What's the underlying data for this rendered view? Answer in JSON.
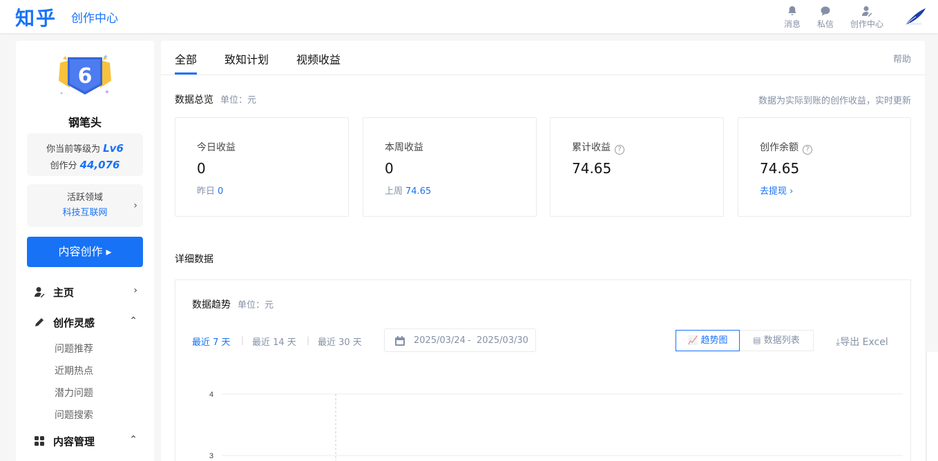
{
  "header": {
    "logo": "知乎",
    "subtitle": "创作中心",
    "items": [
      {
        "label": "消息",
        "icon": "bell-icon"
      },
      {
        "label": "私信",
        "icon": "chat-icon"
      },
      {
        "label": "创作中心",
        "icon": "creator-icon"
      }
    ],
    "avatar_icon": "feather-logo-icon"
  },
  "sidebar": {
    "badge_number": "6",
    "level_name": "钢笔头",
    "level_text": "你当前等级为",
    "level_value": "Lv6",
    "score_text": "创作分",
    "score_value": "44,076",
    "domain_label": "活跃领域",
    "domain_value": "科技互联网",
    "create_button": "内容创作 ▸",
    "nav": [
      {
        "label": "主页",
        "icon": "user-icon",
        "chevron": "›"
      },
      {
        "label": "创作灵感",
        "icon": "pen-icon",
        "chevron": "⌃",
        "children": [
          "问题推荐",
          "近期热点",
          "潜力问题",
          "问题搜索"
        ]
      },
      {
        "label": "内容管理",
        "icon": "grid-icon",
        "chevron": "⌃"
      }
    ]
  },
  "main": {
    "tabs": [
      "全部",
      "致知计划",
      "视频收益"
    ],
    "help": "帮助",
    "overview_title": "数据总览",
    "overview_unit": "单位：元",
    "overview_note": "数据为实际到账的创作收益，实时更新",
    "cards": [
      {
        "title": "今日收益",
        "value": "0",
        "sub_label": "昨日",
        "sub_value": "0"
      },
      {
        "title": "本周收益",
        "value": "0",
        "sub_label": "上周",
        "sub_value": "74.65"
      },
      {
        "title": "累计收益",
        "value": "74.65"
      },
      {
        "title": "创作余额",
        "value": "74.65",
        "link": "去提现 ›"
      }
    ],
    "detail_title": "详细数据",
    "trend_title": "数据趋势",
    "trend_unit": "单位：元",
    "ranges": [
      "最近 7 天",
      "最近 14 天",
      "最近 30 天"
    ],
    "date_start": "2025/03/24",
    "date_sep": "-",
    "date_end": "2025/03/30",
    "view_chart": "趋势图",
    "view_table": "数据列表",
    "export": "导出 Excel"
  },
  "chart_data": {
    "type": "line",
    "y_ticks": [
      "4",
      "3"
    ],
    "x": [],
    "series": []
  },
  "colors": {
    "accent": "#1772f6",
    "muted": "#8590a6"
  }
}
